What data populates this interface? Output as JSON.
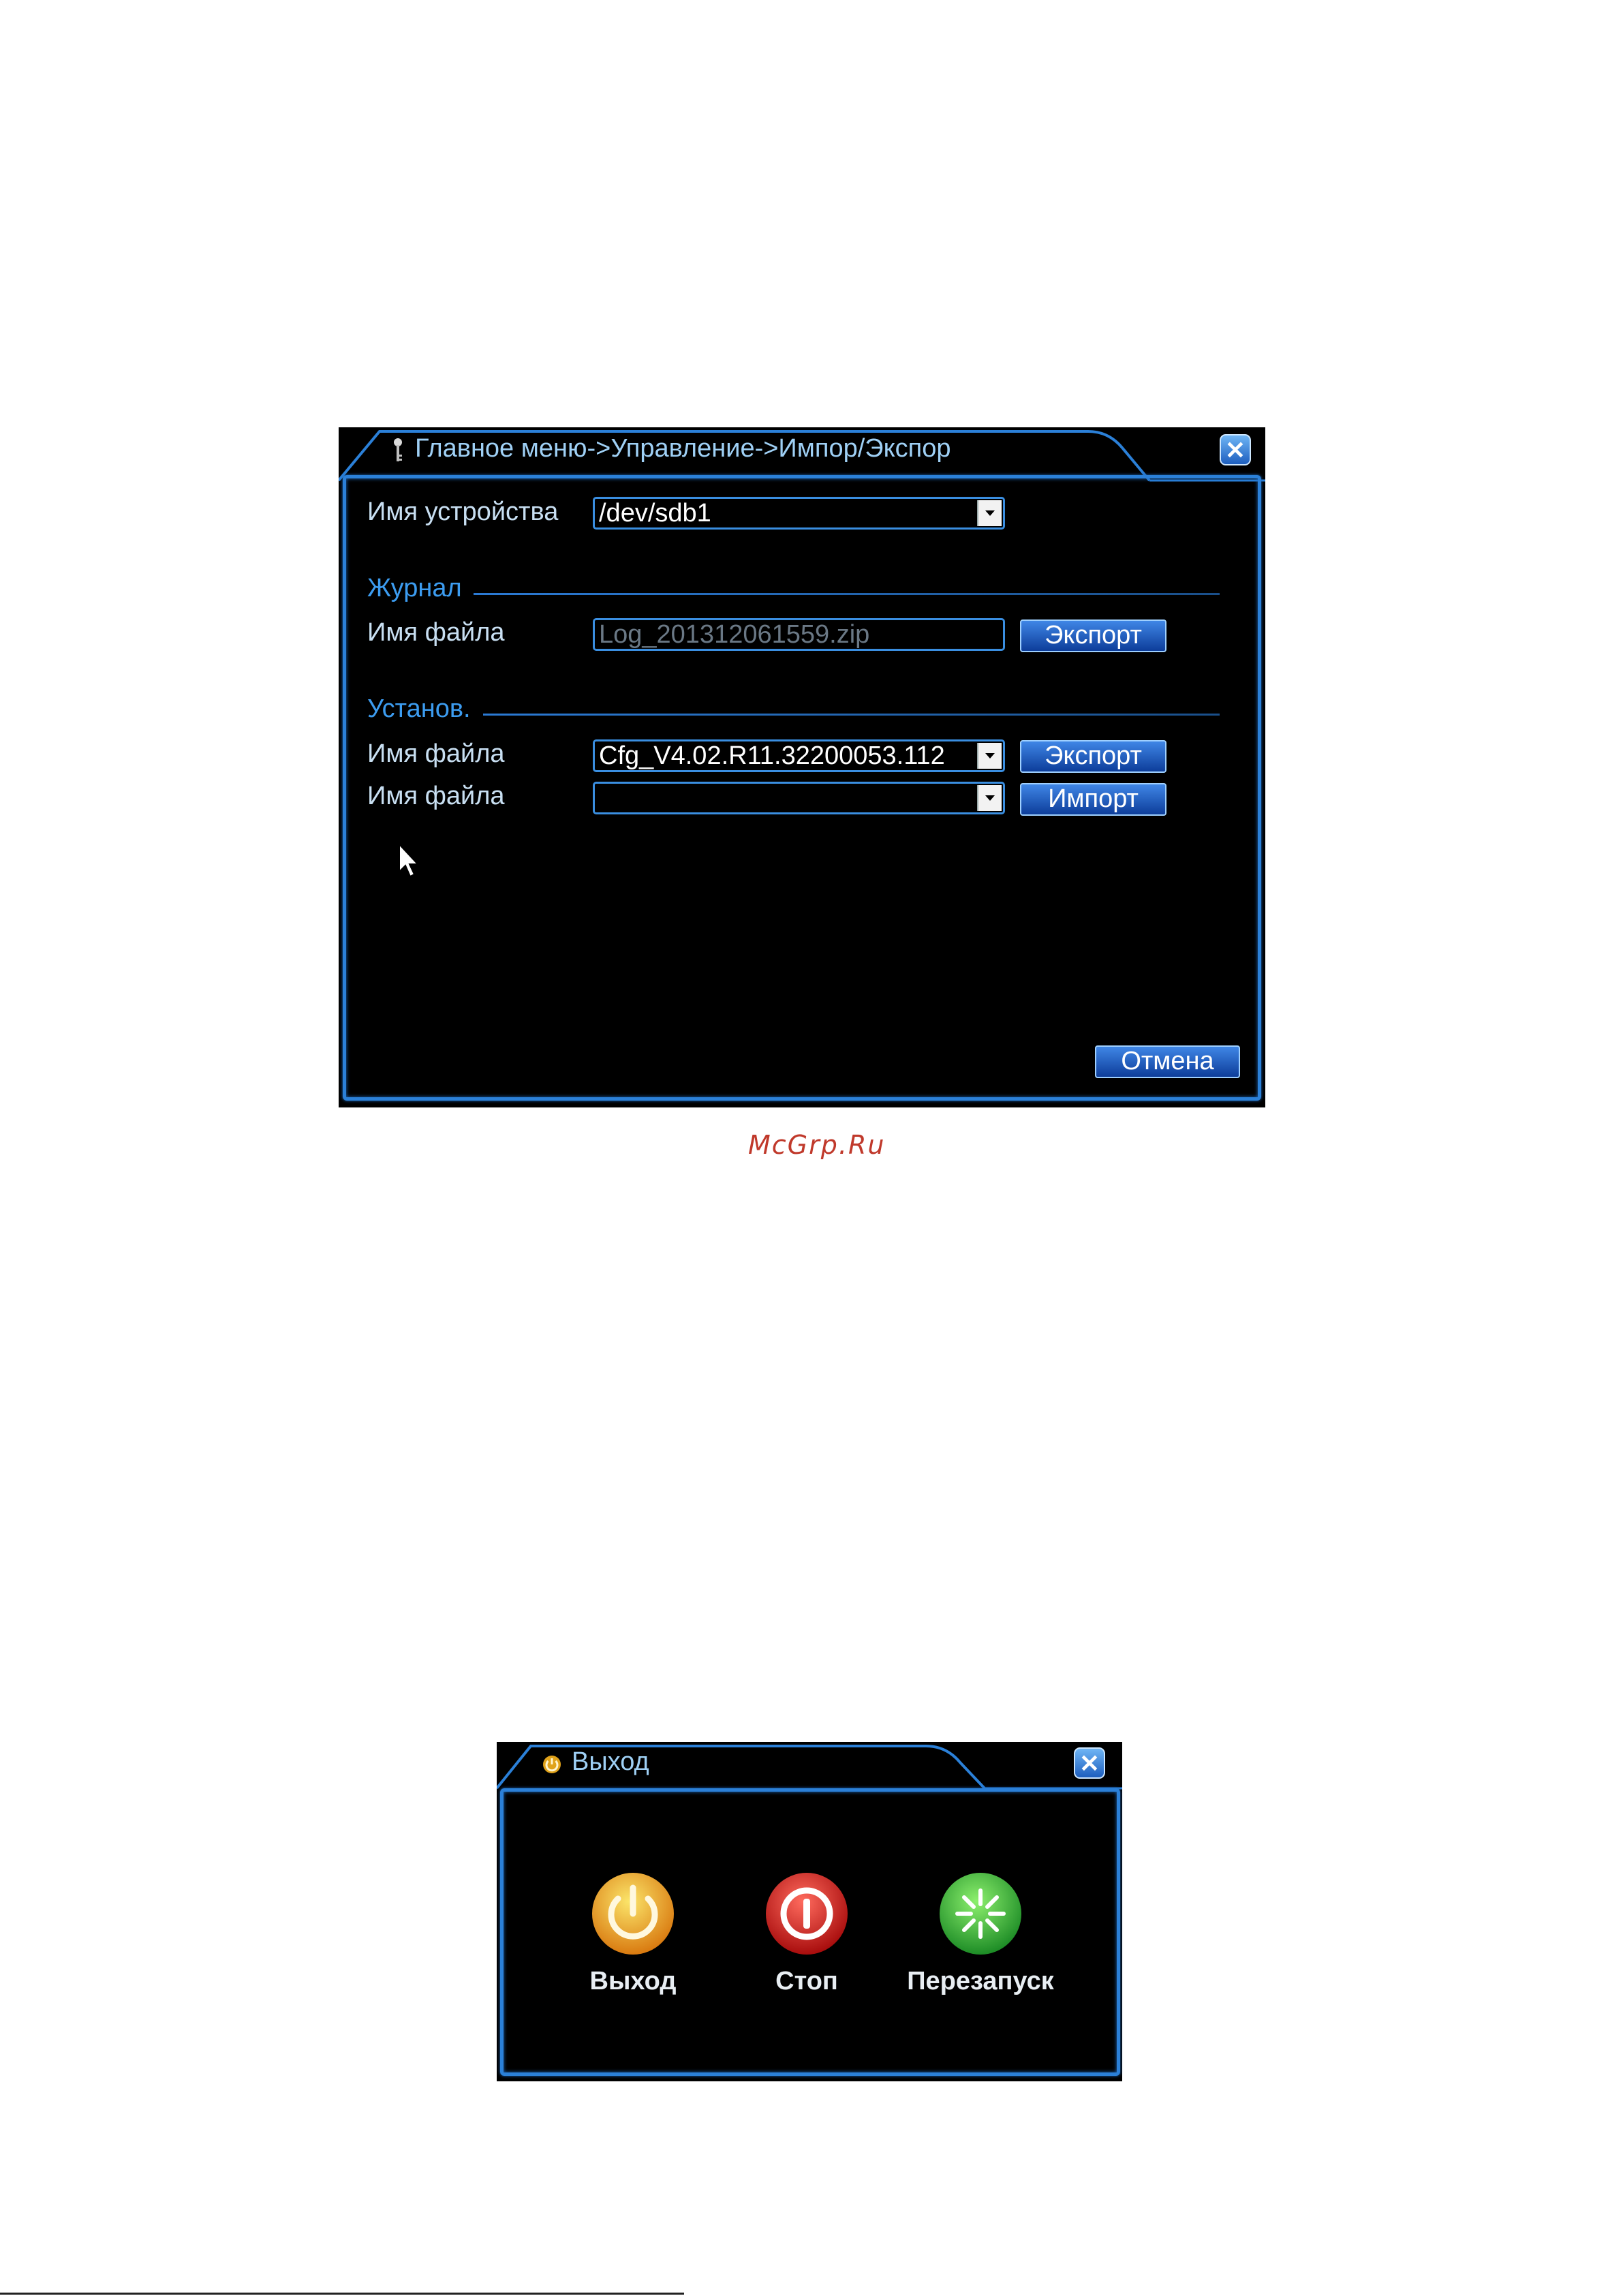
{
  "dialog1": {
    "title": "Главное меню->Управление->Импор/Экспор",
    "close_label": "✕",
    "device_label": "Имя устройства",
    "device_value": "/dev/sdb1",
    "log_section": "Журнал",
    "log_file_label": "Имя файла",
    "log_file_value": "Log_201312061559.zip",
    "log_export_label": "Экспорт",
    "setup_section": "Установ.",
    "cfg_file_label": "Имя файла",
    "cfg_file_value": "Cfg_V4.02.R11.32200053.112",
    "cfg_export_label": "Экспорт",
    "import_file_label": "Имя файла",
    "import_file_value": "",
    "import_label": "Импорт",
    "cancel_label": "Отмена",
    "title_icon": "key-icon",
    "accent": "#2b80d8"
  },
  "watermark": "McGrp.Ru",
  "dialog2": {
    "title": "Выход",
    "title_icon": "power-small-icon",
    "close_label": "✕",
    "items": [
      {
        "label": "Выход",
        "icon": "power-icon",
        "color": "#e8a51c"
      },
      {
        "label": "Стоп",
        "icon": "stop-icon",
        "color": "#d41f1f"
      },
      {
        "label": "Перезапуск",
        "icon": "restart-icon",
        "color": "#3cb43c"
      }
    ]
  }
}
